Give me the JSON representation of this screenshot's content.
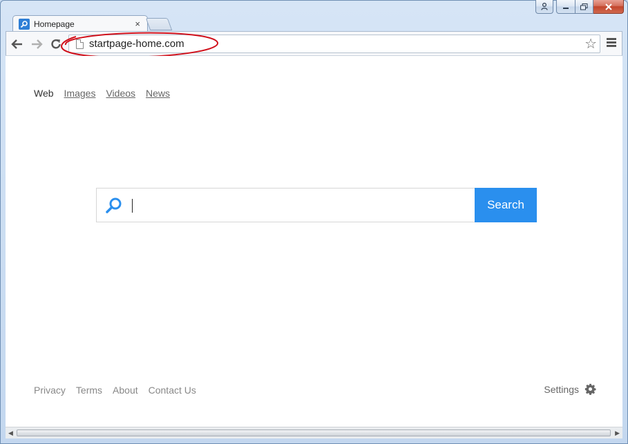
{
  "window": {
    "controls": {
      "minimize_icon": "minimize-icon",
      "maximize_icon": "maximize-icon",
      "close_icon": "close-icon",
      "user_icon": "user-icon"
    }
  },
  "tab": {
    "title": "Homepage",
    "close_glyph": "×"
  },
  "toolbar": {
    "url": "startpage-home.com",
    "back_glyph": "←",
    "forward_glyph": "→",
    "star_glyph": "☆"
  },
  "nav": {
    "items": [
      {
        "label": "Web",
        "active": true
      },
      {
        "label": "Images",
        "active": false
      },
      {
        "label": "Videos",
        "active": false
      },
      {
        "label": "News",
        "active": false
      }
    ]
  },
  "search": {
    "value": "",
    "button_label": "Search",
    "accent_color": "#2a8fee"
  },
  "footer": {
    "links": [
      "Privacy",
      "Terms",
      "About",
      "Contact Us"
    ],
    "settings_label": "Settings"
  },
  "annotation": {
    "ellipse_color": "#d0101b"
  }
}
